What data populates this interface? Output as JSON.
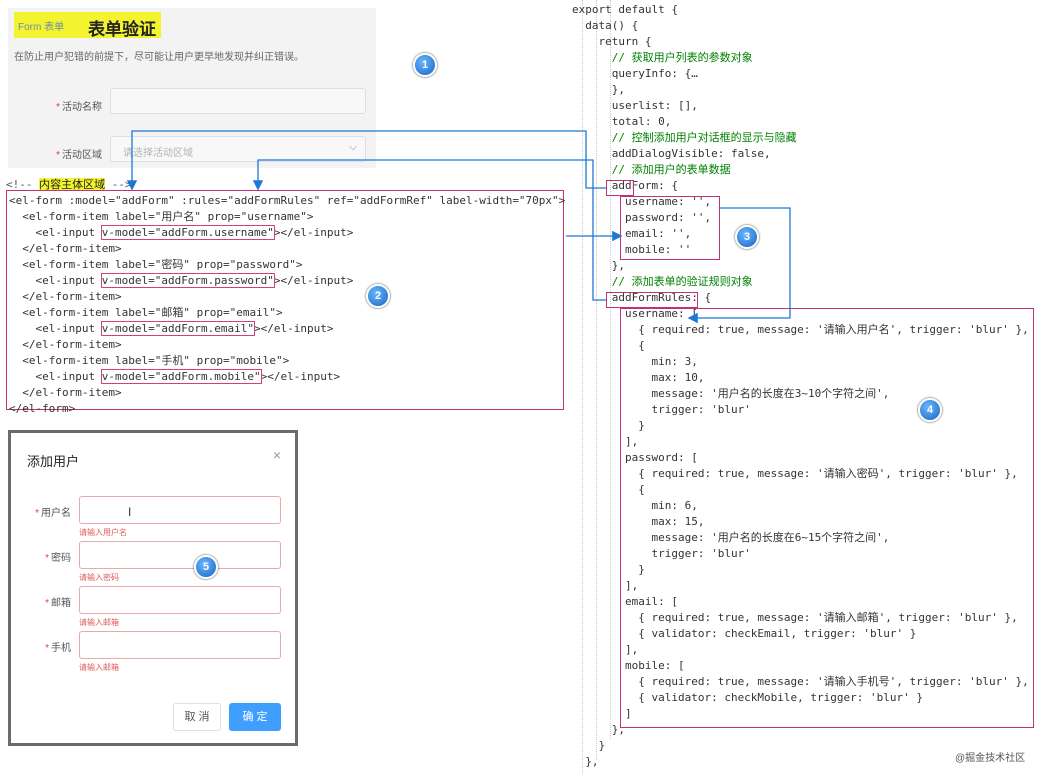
{
  "panel1": {
    "breadcrumb": "Form 表单",
    "title": "表单验证",
    "description": "在防止用户犯错的前提下，尽可能让用户更早地发现并纠正错误。",
    "fields": [
      {
        "label": "活动名称",
        "placeholder": ""
      },
      {
        "label": "活动区域",
        "placeholder": "请选择活动区域"
      }
    ]
  },
  "template_code": {
    "comment_prefix": "<!-- ",
    "comment_text": "内容主体区域",
    "comment_suffix": " -->",
    "lines": [
      "<el-form :model=\"addForm\" :rules=\"addFormRules\" ref=\"addFormRef\" label-width=\"70px\">",
      "  <el-form-item label=\"用户名\" prop=\"username\">",
      "    <el-input v-model=\"addForm.username\"></el-input>",
      "  </el-form-item>",
      "  <el-form-item label=\"密码\" prop=\"password\">",
      "    <el-input v-model=\"addForm.password\"></el-input>",
      "  </el-form-item>",
      "  <el-form-item label=\"邮箱\" prop=\"email\">",
      "    <el-input v-model=\"addForm.email\"></el-input>",
      "  </el-form-item>",
      "  <el-form-item label=\"手机\" prop=\"mobile\">",
      "    <el-input v-model=\"addForm.mobile\"></el-input>",
      "  </el-form-item>",
      "</el-form>"
    ]
  },
  "dialog": {
    "title": "添加用户",
    "close_icon": "×",
    "fields": [
      {
        "label": "用户名",
        "error": "请输入用户名"
      },
      {
        "label": "密码",
        "error": "请输入密码"
      },
      {
        "label": "邮箱",
        "error": "请输入邮箱"
      },
      {
        "label": "手机",
        "error": "请输入邮箱"
      }
    ],
    "cancel_label": "取 消",
    "ok_label": "确 定",
    "accent": "#409eff"
  },
  "script_code": {
    "lines": [
      "export default {",
      "  data() {",
      "    return {",
      "      // 获取用户列表的参数对象",
      "      queryInfo: {…",
      "      },",
      "      userlist: [],",
      "      total: 0,",
      "      // 控制添加用户对话框的显示与隐藏",
      "      addDialogVisible: false,",
      "      // 添加用户的表单数据",
      "      addForm: {",
      "        username: '',",
      "        password: '',",
      "        email: '',",
      "        mobile: ''",
      "      },",
      "      // 添加表单的验证规则对象",
      "      addFormRules: {",
      "        username: [",
      "          { required: true, message: '请输入用户名', trigger: 'blur' },",
      "          {",
      "            min: 3,",
      "            max: 10,",
      "            message: '用户名的长度在3~10个字符之间',",
      "            trigger: 'blur'",
      "          }",
      "        ],",
      "        password: [",
      "          { required: true, message: '请输入密码', trigger: 'blur' },",
      "          {",
      "            min: 6,",
      "            max: 15,",
      "            message: '用户名的长度在6~15个字符之间',",
      "            trigger: 'blur'",
      "          }",
      "        ],",
      "        email: [",
      "          { required: true, message: '请输入邮箱', trigger: 'blur' },",
      "          { validator: checkEmail, trigger: 'blur' }",
      "        ],",
      "        mobile: [",
      "          { required: true, message: '请输入手机号', trigger: 'blur' },",
      "          { validator: checkMobile, trigger: 'blur' }",
      "        ]",
      "      },",
      "    }",
      "  },"
    ]
  },
  "badges": [
    "1",
    "2",
    "3",
    "4",
    "5"
  ],
  "watermark": "@掘金技术社区",
  "colors": {
    "highlight_box": "#c2307a",
    "arrow": "#1e78d6",
    "yellow": "#f3f330"
  }
}
